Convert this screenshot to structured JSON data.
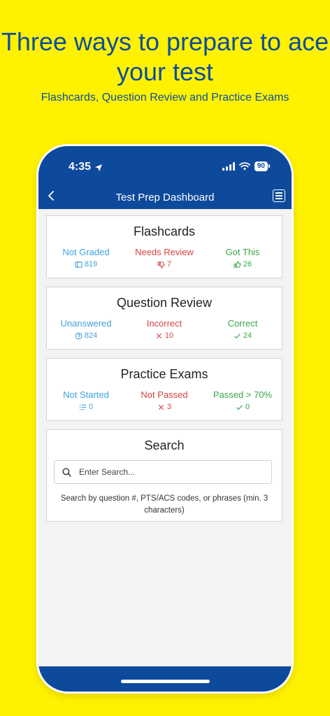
{
  "promo": {
    "headline": "Three ways to prepare to ace your test",
    "subhead": "Flashcards, Question Review and Practice Exams"
  },
  "status_bar": {
    "time": "4:35",
    "battery": "90"
  },
  "nav": {
    "title": "Test Prep Dashboard"
  },
  "flashcards": {
    "title": "Flashcards",
    "stats": [
      {
        "label": "Not Graded",
        "count": "819",
        "icon": "cards-icon",
        "color": "#3FA1DE"
      },
      {
        "label": "Needs Review",
        "count": "7",
        "icon": "thumbs-down-icon",
        "color": "#D9403F"
      },
      {
        "label": "Got This",
        "count": "26",
        "icon": "thumbs-up-icon",
        "color": "#3BA64A"
      }
    ]
  },
  "question_review": {
    "title": "Question Review",
    "stats": [
      {
        "label": "Unanswered",
        "count": "824",
        "icon": "question-icon",
        "color": "#3FA1DE"
      },
      {
        "label": "Incorrect",
        "count": "10",
        "icon": "x-icon",
        "color": "#D9403F"
      },
      {
        "label": "Correct",
        "count": "24",
        "icon": "check-icon",
        "color": "#3BA64A"
      }
    ]
  },
  "practice_exams": {
    "title": "Practice Exams",
    "stats": [
      {
        "label": "Not Started",
        "count": "0",
        "icon": "list-icon",
        "color": "#3FA1DE"
      },
      {
        "label": "Not Passed",
        "count": "3",
        "icon": "x-icon",
        "color": "#D9403F"
      },
      {
        "label": "Passed > 70%",
        "count": "0",
        "icon": "check-icon",
        "color": "#3BA64A"
      }
    ]
  },
  "search": {
    "title": "Search",
    "placeholder": "Enter Search...",
    "help": "Search by question #, PTS/ACS codes, or phrases (min. 3 characters)"
  }
}
